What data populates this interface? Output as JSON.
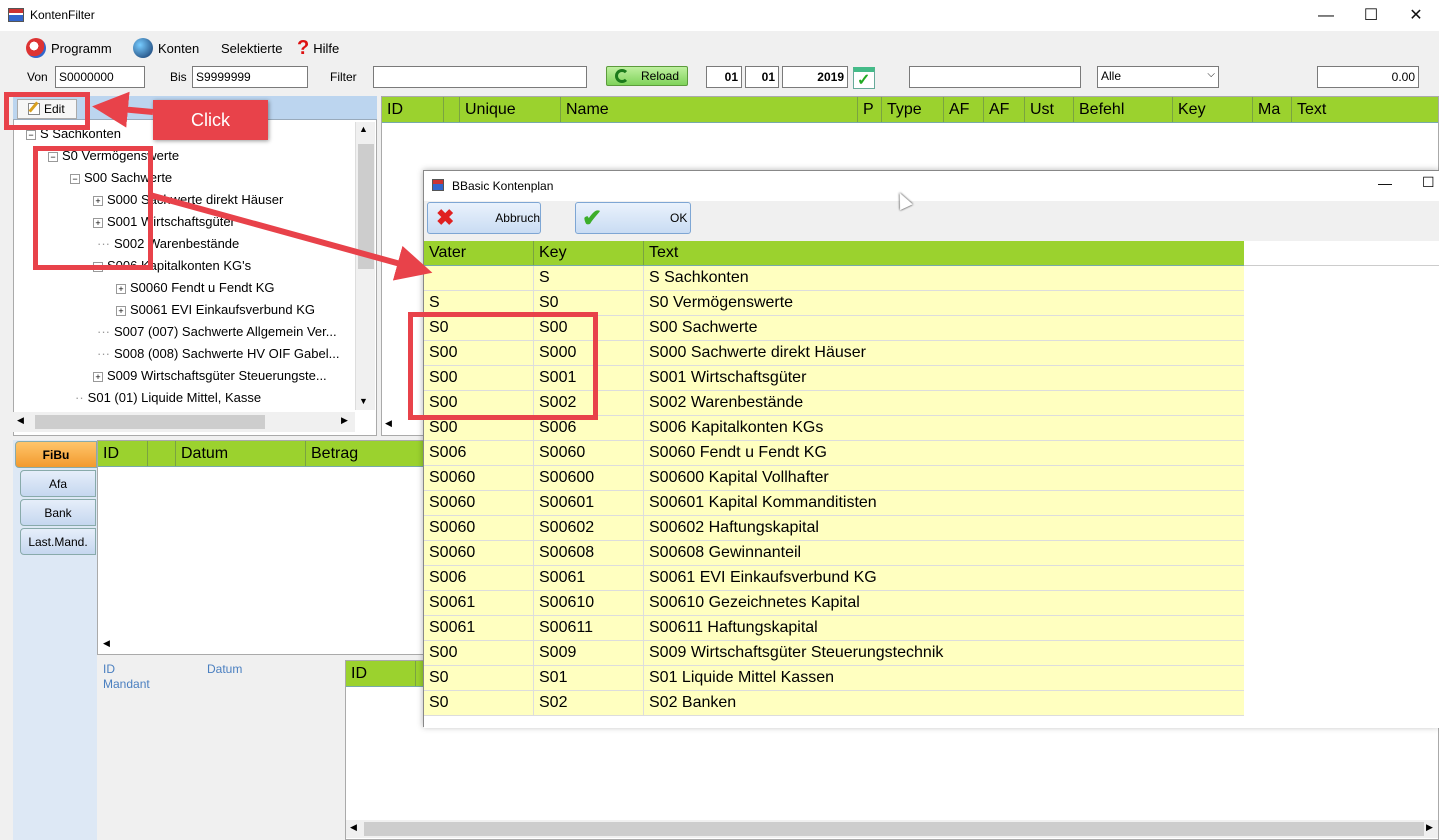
{
  "window": {
    "title": "KontenFilter",
    "controls": [
      "—",
      "☐",
      "✕"
    ]
  },
  "menu": [
    {
      "label": "Programm",
      "icon": "programm-icon"
    },
    {
      "label": "Konten",
      "icon": "globe-icon"
    },
    {
      "label": "Selektierte",
      "icon": ""
    },
    {
      "label": "Hilfe",
      "icon": "question-icon"
    }
  ],
  "filter": {
    "von_label": "Von",
    "von_value": "S0000000",
    "bis_label": "Bis",
    "bis_value": "S9999999",
    "filter_label": "Filter",
    "filter_value": "",
    "reload_label": "Reload",
    "day": "01",
    "month": "01",
    "year": "2019",
    "search_value": "",
    "select_value": "Alle",
    "amount": "0.00"
  },
  "edit_label": "Edit",
  "callout": "Click",
  "tree": [
    {
      "text": "S Sachkonten",
      "exp": "−"
    },
    {
      "text": "S0 Vermögenswerte",
      "exp": "−"
    },
    {
      "text": "S00 Sachwerte",
      "exp": "−"
    },
    {
      "text": "S000 Sachwerte direkt Häuser",
      "exp": "+"
    },
    {
      "text": "S001 Wirtschaftsgüter",
      "exp": "+"
    },
    {
      "text": "S002 Warenbestände",
      "exp": ""
    },
    {
      "text": "S006 Kapitalkonten KG's",
      "exp": "−"
    },
    {
      "text": "S0060 Fendt u Fendt KG",
      "exp": "+"
    },
    {
      "text": "S0061 EVI Einkaufsverbund KG",
      "exp": "+"
    },
    {
      "text": "S007 (007) Sachwerte Allgemein Ver...",
      "exp": ""
    },
    {
      "text": "S008 (008) Sachwerte HV OIF Gabel...",
      "exp": ""
    },
    {
      "text": "S009 Wirtschaftsgüter Steuerungste...",
      "exp": "+"
    },
    {
      "text": "S01 (01) Liquide Mittel, Kasse",
      "exp": ""
    }
  ],
  "main_columns": [
    "ID",
    "",
    "Unique",
    "Name",
    "P",
    "Type",
    "AF",
    "AF",
    "Ust",
    "Befehl",
    "Key",
    "Ma",
    "Text"
  ],
  "tabs": [
    "FiBu",
    "Afa",
    "Bank",
    "Last.Mand."
  ],
  "fibu_columns": [
    "ID",
    "",
    "Datum",
    "Betrag"
  ],
  "info_labels": {
    "id": "ID",
    "mandant": "Mandant",
    "datum": "Datum"
  },
  "sub_columns": [
    "ID"
  ],
  "dialog": {
    "title": "BBasic Kontenplan",
    "cancel_label": "Abbruch",
    "ok_label": "OK",
    "columns": [
      "Vater",
      "Key",
      "Text"
    ],
    "rows": [
      [
        "",
        "S",
        "S Sachkonten"
      ],
      [
        "S",
        "S0",
        "S0 Vermögenswerte"
      ],
      [
        "S0",
        "S00",
        "S00 Sachwerte"
      ],
      [
        "S00",
        "S000",
        "S000 Sachwerte direkt Häuser"
      ],
      [
        "S00",
        "S001",
        "S001 Wirtschaftsgüter"
      ],
      [
        "S00",
        "S002",
        "S002 Warenbestände"
      ],
      [
        "S00",
        "S006",
        "S006 Kapitalkonten KGs"
      ],
      [
        "S006",
        "S0060",
        "S0060 Fendt u Fendt KG"
      ],
      [
        "S0060",
        "S00600",
        "S00600 Kapital Vollhafter"
      ],
      [
        "S0060",
        "S00601",
        "S00601 Kapital Kommanditisten"
      ],
      [
        "S0060",
        "S00602",
        "S00602 Haftungskapital"
      ],
      [
        "S0060",
        "S00608",
        "S00608 Gewinnanteil"
      ],
      [
        "S006",
        "S0061",
        "S0061 EVI Einkaufsverbund KG"
      ],
      [
        "S0061",
        "S00610",
        "S00610 Gezeichnetes Kapital"
      ],
      [
        "S0061",
        "S00611",
        "S00611 Haftungskapital"
      ],
      [
        "S00",
        "S009",
        "S009 Wirtschaftsgüter Steuerungstechnik"
      ],
      [
        "S0",
        "S01",
        "S01 Liquide Mittel Kassen"
      ],
      [
        "S0",
        "S02",
        "S02 Banken"
      ]
    ]
  },
  "colors": {
    "grid_header": "#9bd22e",
    "row_bg": "#ffffc0",
    "annotation": "#e8424a",
    "tab_active": "#f29a2e"
  }
}
